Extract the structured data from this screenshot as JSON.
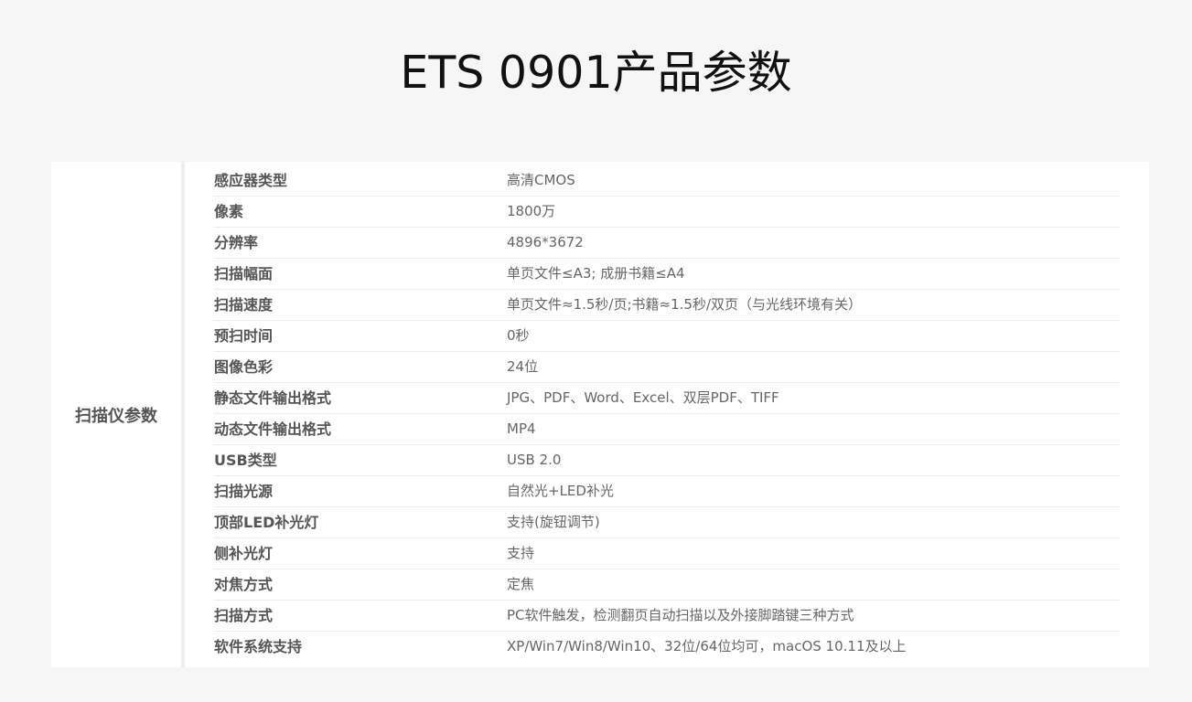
{
  "page": {
    "title": "ETS 0901产品参数"
  },
  "specs": {
    "category": "扫描仪参数",
    "rows": [
      {
        "label": "感应器类型",
        "value": "高清CMOS"
      },
      {
        "label": "像素",
        "value": "1800万"
      },
      {
        "label": "分辨率",
        "value": "4896*3672"
      },
      {
        "label": "扫描幅面",
        "value": "单页文件≤A3; 成册书籍≤A4"
      },
      {
        "label": "扫描速度",
        "value": "单页文件≈1.5秒/页;书籍≈1.5秒/双页（与光线环境有关）"
      },
      {
        "label": "预扫时间",
        "value": "0秒"
      },
      {
        "label": "图像色彩",
        "value": "24位"
      },
      {
        "label": "静态文件输出格式",
        "value": "JPG、PDF、Word、Excel、双层PDF、TIFF"
      },
      {
        "label": "动态文件输出格式",
        "value": "MP4"
      },
      {
        "label": "USB类型",
        "value": "USB 2.0"
      },
      {
        "label": "扫描光源",
        "value": "自然光+LED补光"
      },
      {
        "label": "顶部LED补光灯",
        "value": "支持(旋钮调节)"
      },
      {
        "label": "侧补光灯",
        "value": "支持"
      },
      {
        "label": "对焦方式",
        "value": "定焦"
      },
      {
        "label": "扫描方式",
        "value": "PC软件触发，检测翻页自动扫描以及外接脚踏键三种方式"
      },
      {
        "label": "软件系统支持",
        "value": "XP/Win7/Win8/Win10、32位/64位均可，macOS 10.11及以上"
      }
    ]
  }
}
